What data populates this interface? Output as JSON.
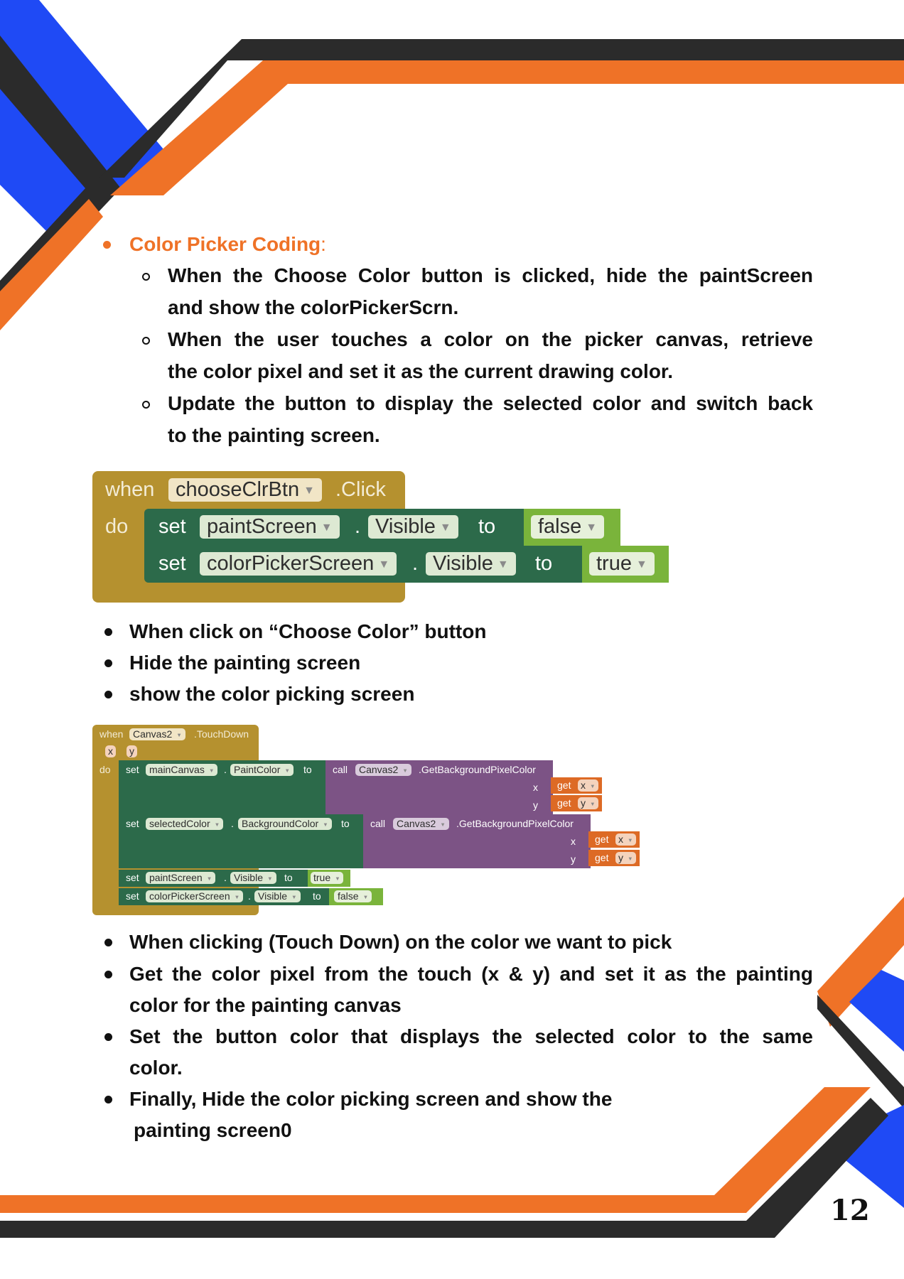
{
  "section": {
    "heading": "Color Picker Coding",
    "heading_colon": ":",
    "subitems": [
      {
        "line1": "When the Choose Color button is clicked, hide the paintScreen",
        "line2": "and show the colorPickerScrn."
      },
      {
        "line1": "When the user touches a color on the picker canvas, retrieve",
        "line2": "the color pixel and set it as the current drawing color."
      },
      {
        "line1": "Update the button to display the selected color and switch back",
        "line2": "to the painting screen."
      }
    ]
  },
  "block1": {
    "when": "when",
    "component": "chooseClrBtn",
    "event": ".Click",
    "do": "do",
    "rows": [
      {
        "set": "set",
        "component": "paintScreen",
        "dot": ".",
        "property": "Visible",
        "to": "to",
        "value": "false"
      },
      {
        "set": "set",
        "component": "colorPickerScreen",
        "dot": ".",
        "property": "Visible",
        "to": "to",
        "value": "true"
      }
    ]
  },
  "bullets1": [
    "When click on “Choose Color” button",
    "Hide the painting screen",
    "show the color picking screen"
  ],
  "block2": {
    "when": "when",
    "component": "Canvas2",
    "event": ".TouchDown",
    "param_x": "x",
    "param_y": "y",
    "do": "do",
    "set1": {
      "set": "set",
      "component": "mainCanvas",
      "dot": ".",
      "property": "PaintColor",
      "to": "to",
      "call": "call",
      "call_component": "Canvas2",
      "method": ".GetBackgroundPixelColor",
      "x_label": "x",
      "y_label": "y",
      "get": "get",
      "get_x": "x",
      "get_y": "y"
    },
    "set2": {
      "set": "set",
      "component": "selectedColor",
      "dot": ".",
      "property": "BackgroundColor",
      "to": "to",
      "call": "call",
      "call_component": "Canvas2",
      "method": ".GetBackgroundPixelColor",
      "x_label": "x",
      "y_label": "y",
      "get": "get",
      "get_x": "x",
      "get_y": "y"
    },
    "set3": {
      "set": "set",
      "component": "paintScreen",
      "dot": ".",
      "property": "Visible",
      "to": "to",
      "value": "true"
    },
    "set4": {
      "set": "set",
      "component": "colorPickerScreen",
      "dot": ".",
      "property": "Visible",
      "to": "to",
      "value": "false"
    }
  },
  "bullets2": {
    "b1": "When clicking (Touch Down) on the color we want to pick",
    "b2_line1": "Get the color pixel from the touch (x & y) and set it as the painting",
    "b2_line2": "color for the painting canvas",
    "b3_line1": "Set the button color that displays the selected color to the same",
    "b3_line2": "color.",
    "b4_line1": "Finally, Hide the color picking screen and show the",
    "b4_line2": "painting screen0"
  },
  "page_number": "12",
  "colors": {
    "orange": "#ef7227",
    "blue": "#1f4af5",
    "dark": "#2b2b2b",
    "block_event": "#b5912f",
    "block_set": "#2c6a4a",
    "block_call": "#7c5385",
    "block_bool": "#7ab43b",
    "block_get": "#dd6a25"
  }
}
